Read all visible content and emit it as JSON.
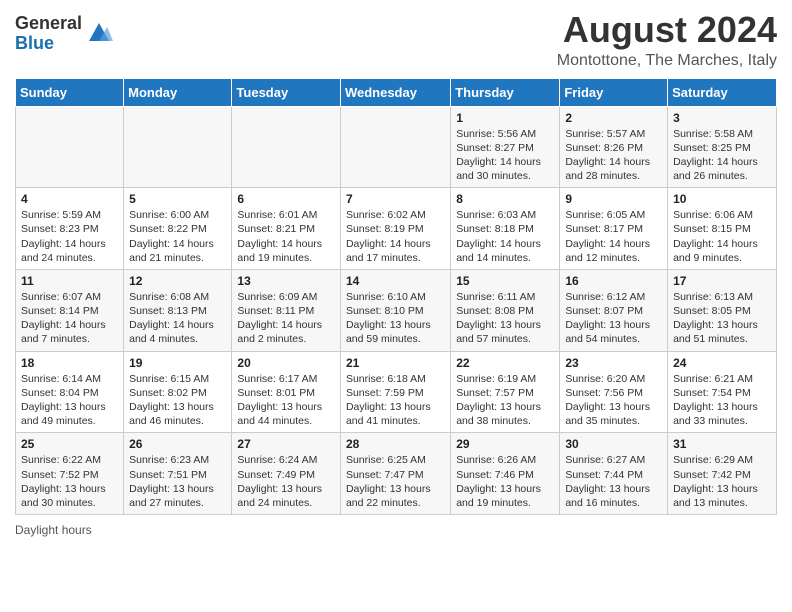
{
  "logo": {
    "general": "General",
    "blue": "Blue"
  },
  "title": "August 2024",
  "location": "Montottone, The Marches, Italy",
  "days_header": [
    "Sunday",
    "Monday",
    "Tuesday",
    "Wednesday",
    "Thursday",
    "Friday",
    "Saturday"
  ],
  "weeks": [
    [
      {
        "day": "",
        "info": ""
      },
      {
        "day": "",
        "info": ""
      },
      {
        "day": "",
        "info": ""
      },
      {
        "day": "",
        "info": ""
      },
      {
        "day": "1",
        "info": "Sunrise: 5:56 AM\nSunset: 8:27 PM\nDaylight: 14 hours and 30 minutes."
      },
      {
        "day": "2",
        "info": "Sunrise: 5:57 AM\nSunset: 8:26 PM\nDaylight: 14 hours and 28 minutes."
      },
      {
        "day": "3",
        "info": "Sunrise: 5:58 AM\nSunset: 8:25 PM\nDaylight: 14 hours and 26 minutes."
      }
    ],
    [
      {
        "day": "4",
        "info": "Sunrise: 5:59 AM\nSunset: 8:23 PM\nDaylight: 14 hours and 24 minutes."
      },
      {
        "day": "5",
        "info": "Sunrise: 6:00 AM\nSunset: 8:22 PM\nDaylight: 14 hours and 21 minutes."
      },
      {
        "day": "6",
        "info": "Sunrise: 6:01 AM\nSunset: 8:21 PM\nDaylight: 14 hours and 19 minutes."
      },
      {
        "day": "7",
        "info": "Sunrise: 6:02 AM\nSunset: 8:19 PM\nDaylight: 14 hours and 17 minutes."
      },
      {
        "day": "8",
        "info": "Sunrise: 6:03 AM\nSunset: 8:18 PM\nDaylight: 14 hours and 14 minutes."
      },
      {
        "day": "9",
        "info": "Sunrise: 6:05 AM\nSunset: 8:17 PM\nDaylight: 14 hours and 12 minutes."
      },
      {
        "day": "10",
        "info": "Sunrise: 6:06 AM\nSunset: 8:15 PM\nDaylight: 14 hours and 9 minutes."
      }
    ],
    [
      {
        "day": "11",
        "info": "Sunrise: 6:07 AM\nSunset: 8:14 PM\nDaylight: 14 hours and 7 minutes."
      },
      {
        "day": "12",
        "info": "Sunrise: 6:08 AM\nSunset: 8:13 PM\nDaylight: 14 hours and 4 minutes."
      },
      {
        "day": "13",
        "info": "Sunrise: 6:09 AM\nSunset: 8:11 PM\nDaylight: 14 hours and 2 minutes."
      },
      {
        "day": "14",
        "info": "Sunrise: 6:10 AM\nSunset: 8:10 PM\nDaylight: 13 hours and 59 minutes."
      },
      {
        "day": "15",
        "info": "Sunrise: 6:11 AM\nSunset: 8:08 PM\nDaylight: 13 hours and 57 minutes."
      },
      {
        "day": "16",
        "info": "Sunrise: 6:12 AM\nSunset: 8:07 PM\nDaylight: 13 hours and 54 minutes."
      },
      {
        "day": "17",
        "info": "Sunrise: 6:13 AM\nSunset: 8:05 PM\nDaylight: 13 hours and 51 minutes."
      }
    ],
    [
      {
        "day": "18",
        "info": "Sunrise: 6:14 AM\nSunset: 8:04 PM\nDaylight: 13 hours and 49 minutes."
      },
      {
        "day": "19",
        "info": "Sunrise: 6:15 AM\nSunset: 8:02 PM\nDaylight: 13 hours and 46 minutes."
      },
      {
        "day": "20",
        "info": "Sunrise: 6:17 AM\nSunset: 8:01 PM\nDaylight: 13 hours and 44 minutes."
      },
      {
        "day": "21",
        "info": "Sunrise: 6:18 AM\nSunset: 7:59 PM\nDaylight: 13 hours and 41 minutes."
      },
      {
        "day": "22",
        "info": "Sunrise: 6:19 AM\nSunset: 7:57 PM\nDaylight: 13 hours and 38 minutes."
      },
      {
        "day": "23",
        "info": "Sunrise: 6:20 AM\nSunset: 7:56 PM\nDaylight: 13 hours and 35 minutes."
      },
      {
        "day": "24",
        "info": "Sunrise: 6:21 AM\nSunset: 7:54 PM\nDaylight: 13 hours and 33 minutes."
      }
    ],
    [
      {
        "day": "25",
        "info": "Sunrise: 6:22 AM\nSunset: 7:52 PM\nDaylight: 13 hours and 30 minutes."
      },
      {
        "day": "26",
        "info": "Sunrise: 6:23 AM\nSunset: 7:51 PM\nDaylight: 13 hours and 27 minutes."
      },
      {
        "day": "27",
        "info": "Sunrise: 6:24 AM\nSunset: 7:49 PM\nDaylight: 13 hours and 24 minutes."
      },
      {
        "day": "28",
        "info": "Sunrise: 6:25 AM\nSunset: 7:47 PM\nDaylight: 13 hours and 22 minutes."
      },
      {
        "day": "29",
        "info": "Sunrise: 6:26 AM\nSunset: 7:46 PM\nDaylight: 13 hours and 19 minutes."
      },
      {
        "day": "30",
        "info": "Sunrise: 6:27 AM\nSunset: 7:44 PM\nDaylight: 13 hours and 16 minutes."
      },
      {
        "day": "31",
        "info": "Sunrise: 6:29 AM\nSunset: 7:42 PM\nDaylight: 13 hours and 13 minutes."
      }
    ]
  ],
  "footer": "Daylight hours"
}
